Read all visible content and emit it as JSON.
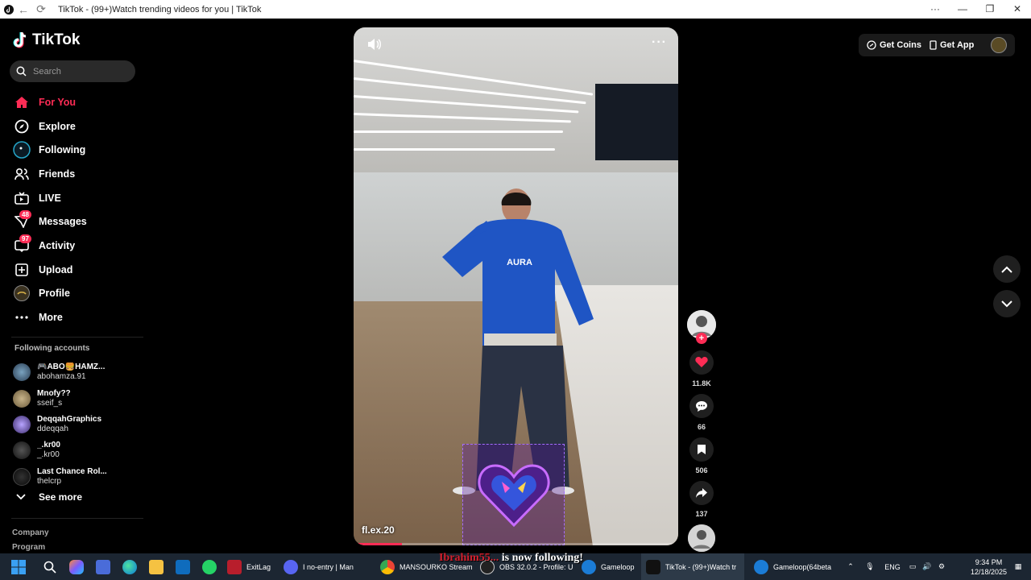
{
  "window": {
    "title": "TikTok - (99+)Watch trending videos for you | TikTok"
  },
  "sidebar": {
    "logo": "TikTok",
    "search_placeholder": "Search",
    "items": [
      {
        "label": "For You",
        "icon": "home-icon",
        "active": true
      },
      {
        "label": "Explore",
        "icon": "compass-icon"
      },
      {
        "label": "Following",
        "icon": "following-icon"
      },
      {
        "label": "Friends",
        "icon": "friends-icon"
      },
      {
        "label": "LIVE",
        "icon": "live-icon"
      },
      {
        "label": "Messages",
        "icon": "messages-icon",
        "badge": "48"
      },
      {
        "label": "Activity",
        "icon": "activity-icon",
        "badge": "97"
      },
      {
        "label": "Upload",
        "icon": "upload-icon"
      },
      {
        "label": "Profile",
        "icon": "profile-avatar"
      },
      {
        "label": "More",
        "icon": "more-icon"
      }
    ],
    "following_title": "Following accounts",
    "accounts": [
      {
        "display": "🎮ABO🍔HAMZ...",
        "username": "abohamza.91"
      },
      {
        "display": "Mnofy??",
        "username": "sseif_s"
      },
      {
        "display": "DeqqahGraphics",
        "username": "ddeqqah"
      },
      {
        "display": "_.kr00",
        "username": "_.kr00"
      },
      {
        "display": "Last Chance Rol...",
        "username": "thelcrp"
      }
    ],
    "see_more": "See more",
    "footer": [
      "Company",
      "Program"
    ]
  },
  "video": {
    "author": "fl.ex.20",
    "progress": 0.15
  },
  "actions": {
    "likes": "11.8K",
    "comments": "66",
    "saves": "506",
    "shares": "137"
  },
  "topbar": {
    "get_coins": "Get Coins",
    "get_app": "Get App"
  },
  "taskbar": {
    "items": [
      {
        "label": "ExitLag"
      },
      {
        "label": "I no-entry | Man"
      },
      {
        "label": "MANSOURKO Stream"
      },
      {
        "label": "OBS 32.0.2 - Profile: U"
      },
      {
        "label": "Gameloop"
      },
      {
        "label": "TikTok - (99+)Watch tr"
      },
      {
        "label": "Gameloop(64beta"
      }
    ],
    "overlay_name": "Ibrahim55...",
    "overlay_text": "is now following!",
    "lang": "ENG",
    "time": "9:34 PM",
    "date": "12/18/2025"
  }
}
